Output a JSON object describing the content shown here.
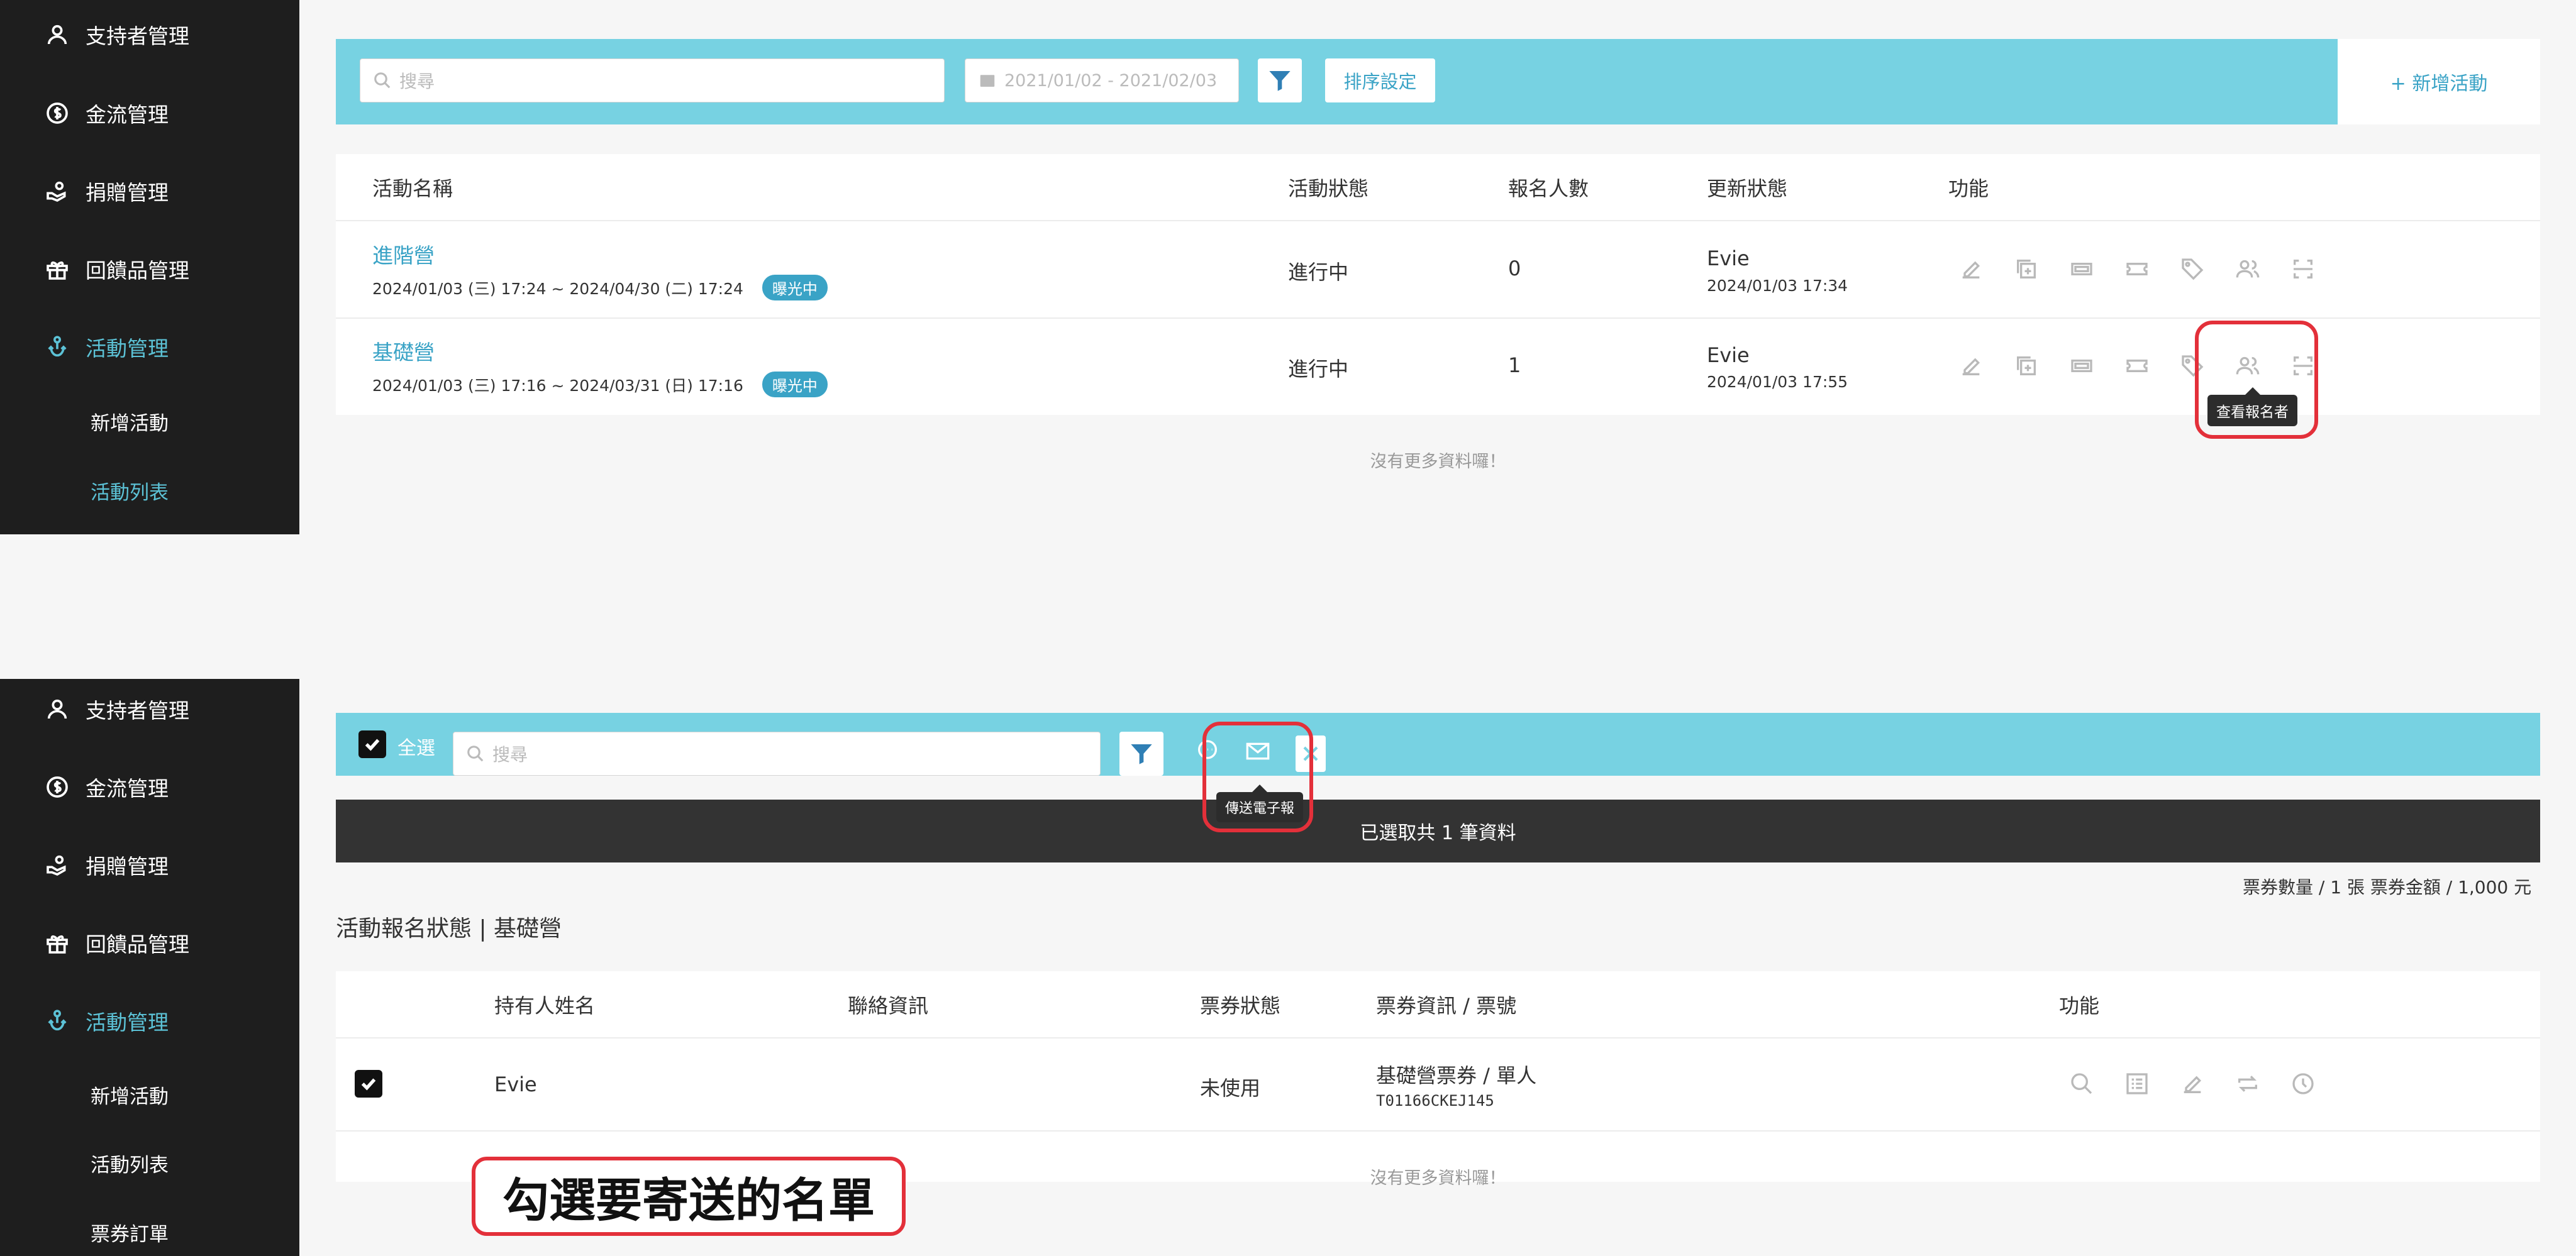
{
  "sidebar": {
    "items": [
      {
        "label": "支持者管理",
        "icon": "user-icon"
      },
      {
        "label": "金流管理",
        "icon": "dollar-circle-icon"
      },
      {
        "label": "捐贈管理",
        "icon": "donate-hand-icon"
      },
      {
        "label": "回饋品管理",
        "icon": "gift-icon"
      },
      {
        "label": "活動管理",
        "icon": "activity-icon"
      }
    ],
    "top_subitems": [
      "新增活動",
      "活動列表"
    ],
    "bottom_subitems": [
      "新增活動",
      "活動列表",
      "票券訂單"
    ]
  },
  "top": {
    "search_placeholder": "搜尋",
    "date_range": "2021/01/02 - 2021/02/03",
    "sort_button": "排序設定",
    "add_button": "+ 新增活動",
    "columns": [
      "活動名稱",
      "活動狀態",
      "報名人數",
      "更新狀態",
      "功能"
    ],
    "rows": [
      {
        "name": "進階營",
        "period": "2024/01/03 (三) 17:24 ~ 2024/04/30 (二) 17:24",
        "badge": "曝光中",
        "status": "進行中",
        "count": "0",
        "updater": "Evie",
        "updated": "2024/01/03 17:34"
      },
      {
        "name": "基礎營",
        "period": "2024/01/03 (三) 17:16 ~ 2024/03/31 (日) 17:16",
        "badge": "曝光中",
        "status": "進行中",
        "count": "1",
        "updater": "Evie",
        "updated": "2024/01/03 17:55"
      }
    ],
    "tooltip": "查看報名者",
    "no_more": "沒有更多資料囉！"
  },
  "bottom": {
    "select_all": "全選",
    "search_placeholder": "搜尋",
    "tooltip": "傳送電子報",
    "selected_text": "已選取共 1 筆資料",
    "summary": "票券數量 / 1 張  票券金額 / 1,000 元",
    "title": "活動報名狀態 | 基礎營",
    "columns": [
      "持有人姓名",
      "聯絡資訊",
      "票券狀態",
      "票券資訊 / 票號",
      "功能"
    ],
    "row": {
      "holder": "Evie",
      "contact": "",
      "status": "未使用",
      "ticket": "基礎營票券 / 單人",
      "ticket_no": "T01166CKEJ145"
    },
    "no_more": "沒有更多資料囉！",
    "callout": "勾選要寄送的名單"
  },
  "colors": {
    "accent": "#5cc2d6",
    "toolbar": "#77d2e2",
    "link": "#3aa3c6",
    "highlight": "#e3303a"
  }
}
